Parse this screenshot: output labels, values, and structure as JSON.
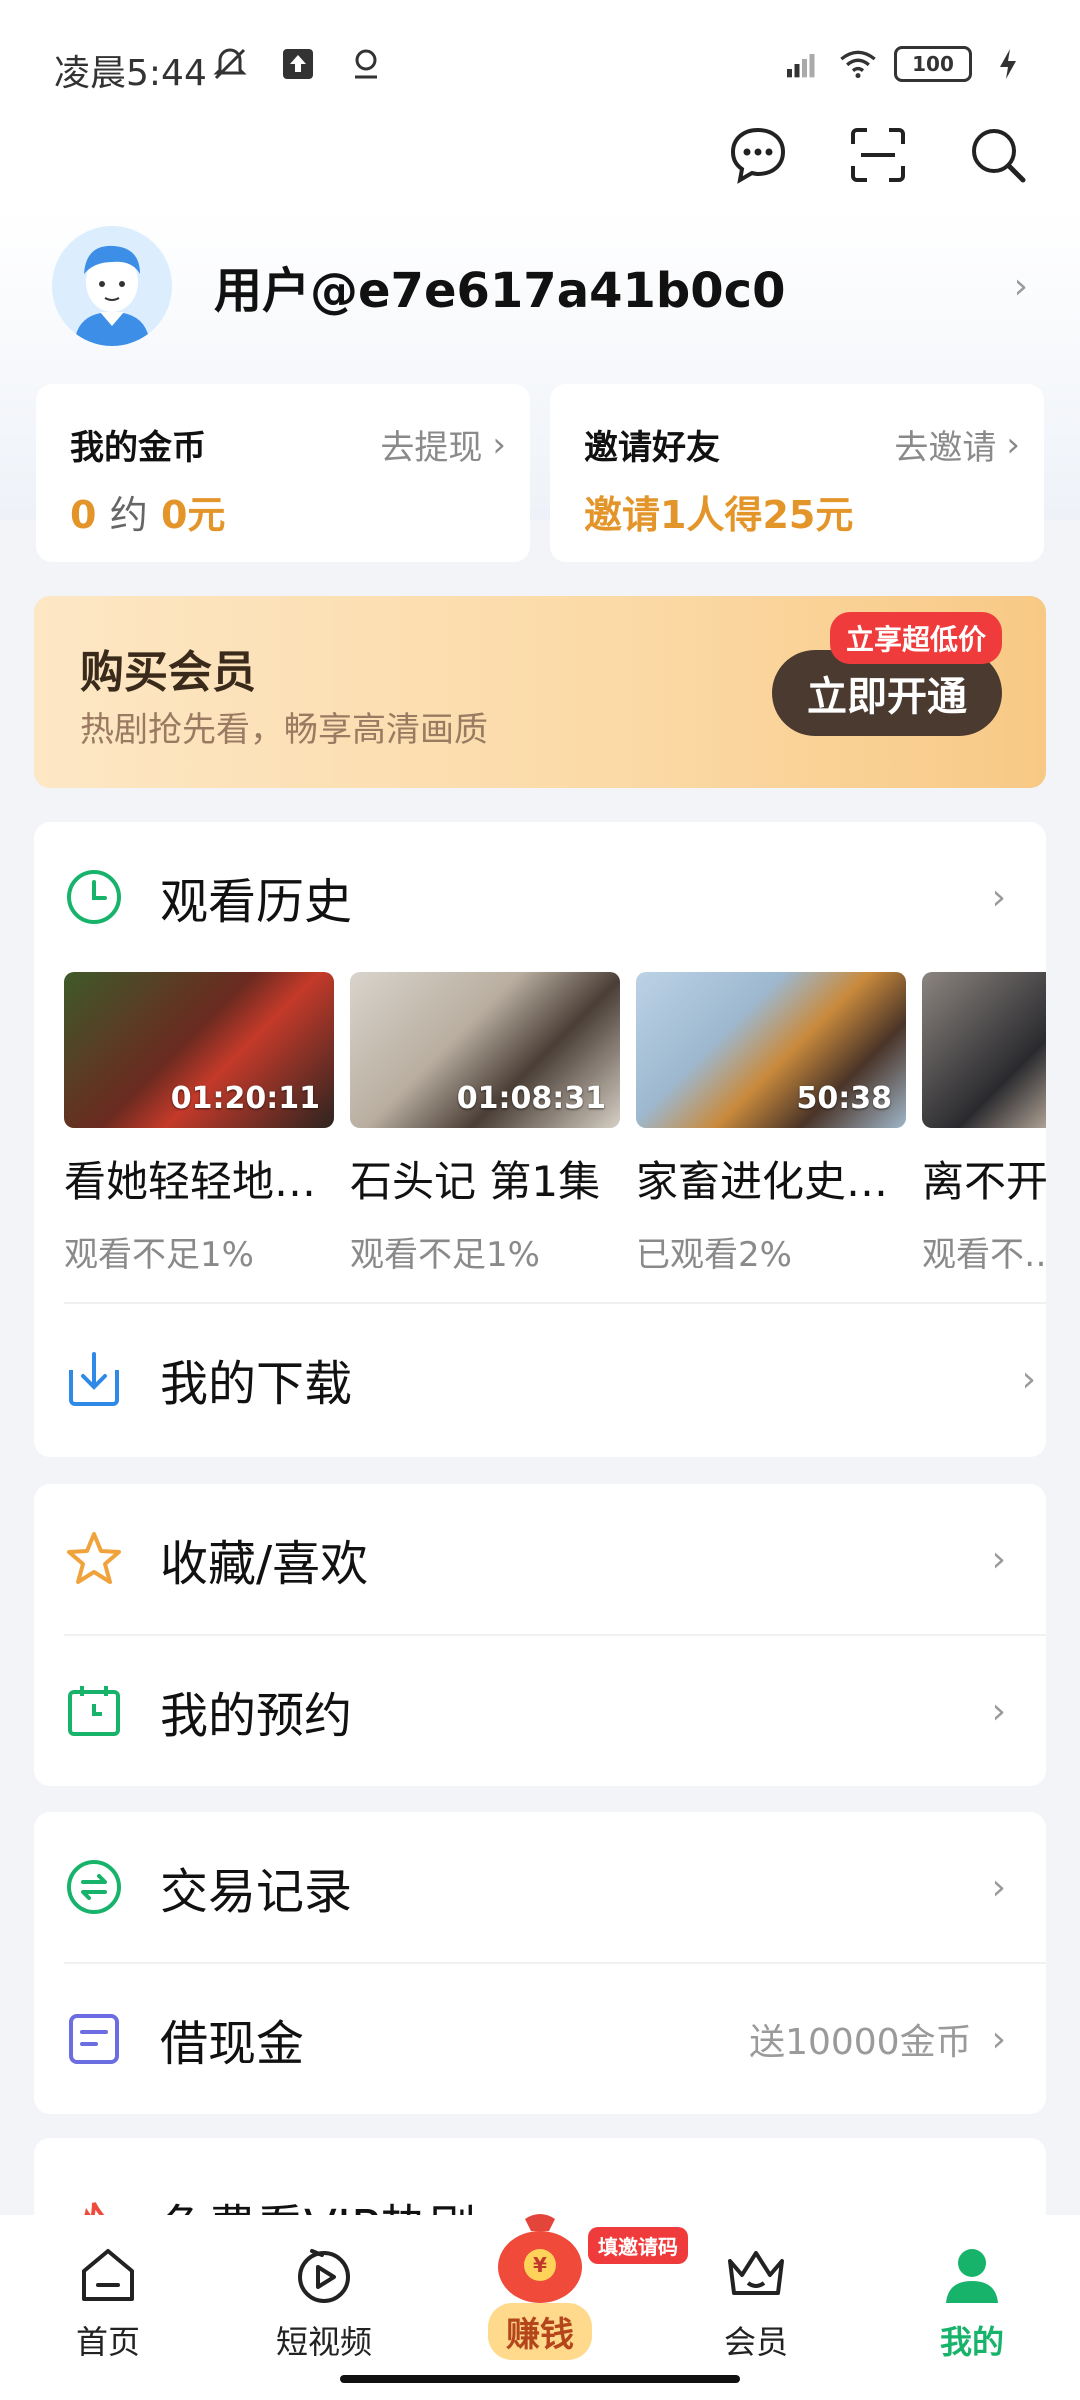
{
  "status_bar": {
    "time": "凌晨5:44",
    "battery": "100"
  },
  "profile": {
    "username": "用户@e7e617a41b0c0"
  },
  "coins": {
    "title": "我的金币",
    "link": "去提现",
    "amount_coin": "0",
    "approx": "约",
    "amount_cny": "0元"
  },
  "invite": {
    "title": "邀请好友",
    "link": "去邀请",
    "reward": "邀请1人得25元"
  },
  "vip_banner": {
    "title": "购买会员",
    "subtitle": "热剧抢先看，畅享高清画质",
    "button": "立即开通",
    "badge": "立享超低价"
  },
  "history": {
    "title": "观看历史",
    "items": [
      {
        "title": "看她轻轻地…",
        "duration": "01:20:11",
        "progress": "观看不足1%",
        "thumb_color": "#5b2a24"
      },
      {
        "title": "石头记 第1集",
        "duration": "01:08:31",
        "progress": "观看不足1%",
        "thumb_color": "#9c8f82"
      },
      {
        "title": "家畜进化史…",
        "duration": "50:38",
        "progress": "已观看2%",
        "thumb_color": "#8aa7bf"
      },
      {
        "title": "离不开…",
        "duration": "",
        "progress": "观看不…",
        "thumb_color": "#6d6a68"
      }
    ]
  },
  "menu": {
    "downloads": "我的下载",
    "favorites": "收藏/喜欢",
    "reservations": "我的预约",
    "transactions": "交易记录",
    "loan": "借现金",
    "loan_extra": "送10000金币",
    "vip_free": "免费看VIP热剧"
  },
  "bottom_nav": {
    "home": "首页",
    "short_video": "短视频",
    "earn": "赚钱",
    "earn_badge": "填邀请码",
    "member": "会员",
    "mine": "我的"
  },
  "colors": {
    "accent_green": "#18b36a",
    "coin_orange": "#e4952a"
  }
}
